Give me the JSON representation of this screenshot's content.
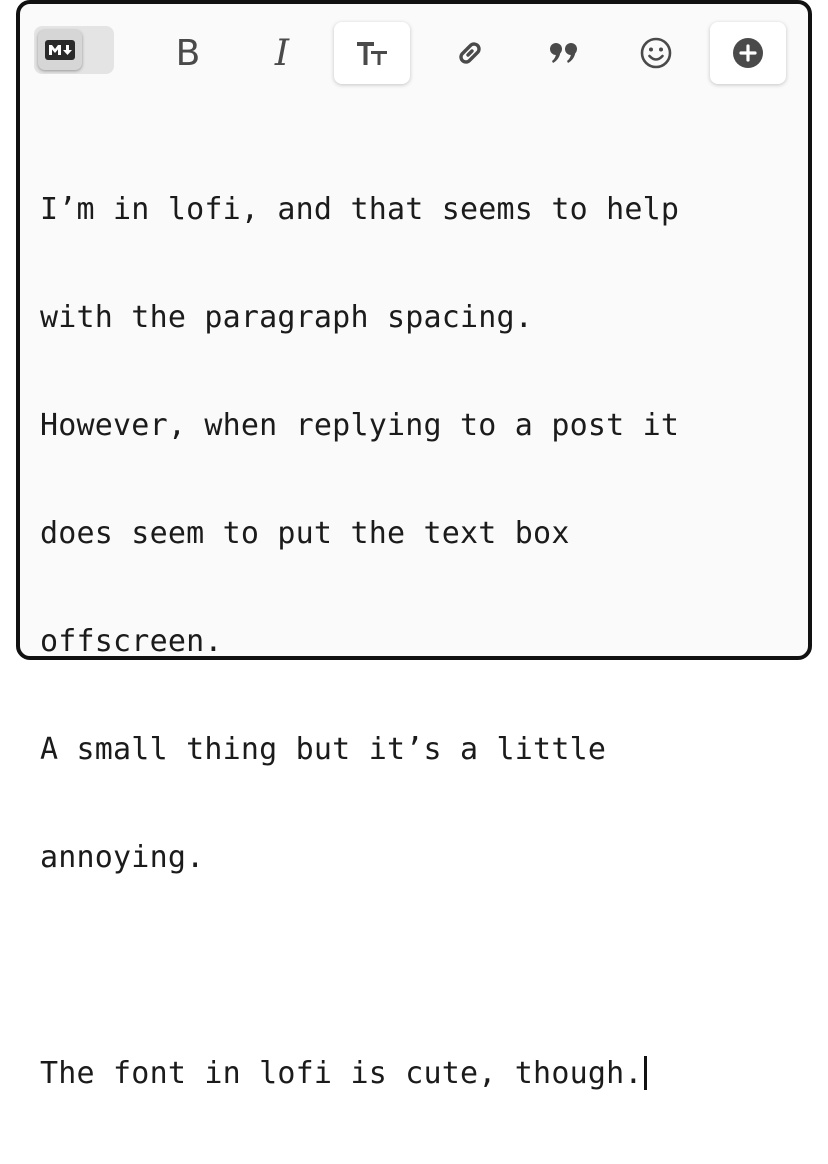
{
  "toolbar": {
    "buttons": [
      {
        "id": "markdown-toggle",
        "label": "M↓"
      },
      {
        "id": "bold",
        "label": "B"
      },
      {
        "id": "italic",
        "label": "I"
      },
      {
        "id": "heading",
        "label": "TT"
      },
      {
        "id": "link",
        "label": ""
      },
      {
        "id": "quote",
        "label": ""
      },
      {
        "id": "emoji",
        "label": ""
      },
      {
        "id": "insert",
        "label": ""
      }
    ]
  },
  "editor": {
    "lines": [
      "I’m in lofi, and that seems to help",
      "with the paragraph spacing.",
      "However, when replying to a post it",
      "does seem to put the text box",
      "offscreen.",
      "A small thing but it’s a little",
      "annoying.",
      "",
      "The font in lofi is cute, though."
    ]
  },
  "colors": {
    "frame_border": "#111111",
    "editor_bg": "#fafafa",
    "icon": "#4a4a4a",
    "text": "#1b1b1b"
  }
}
